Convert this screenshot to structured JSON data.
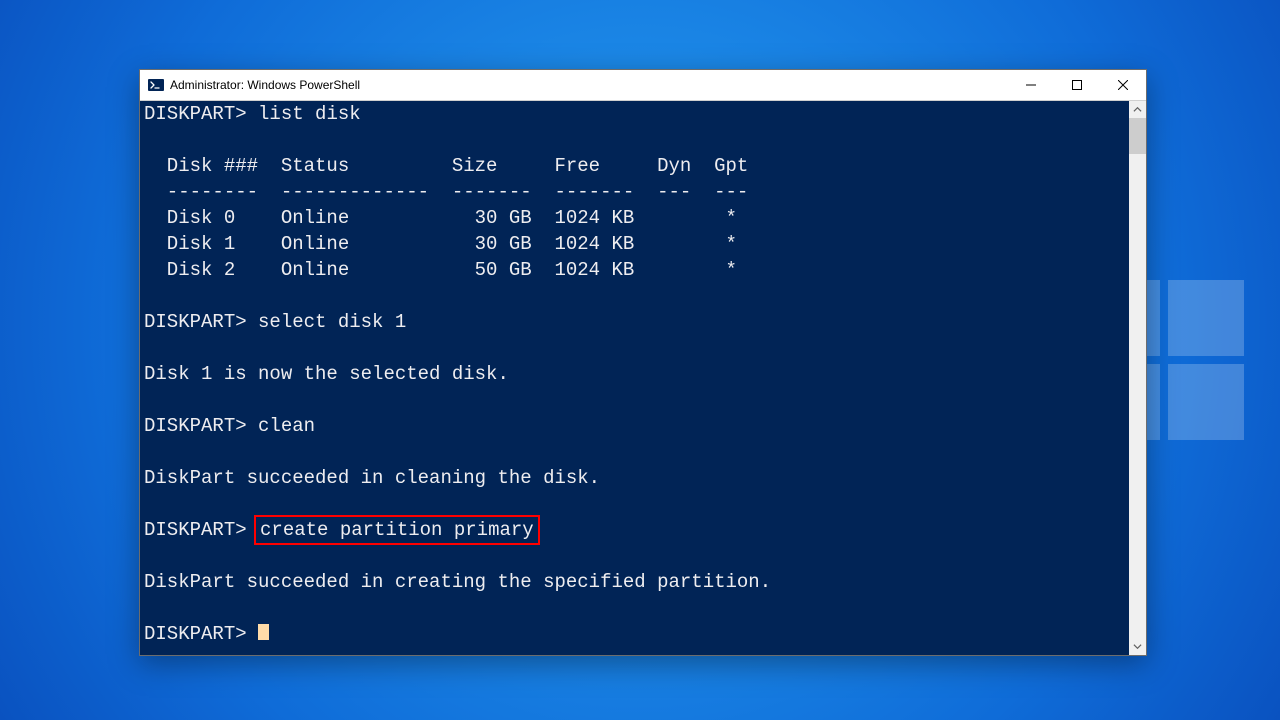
{
  "window": {
    "title": "Administrator: Windows PowerShell"
  },
  "terminal": {
    "prompt": "DISKPART>",
    "cmd_list_disk": "list disk",
    "header": "  Disk ###  Status         Size     Free     Dyn  Gpt",
    "divider": "  --------  -------------  -------  -------  ---  ---",
    "row0": "  Disk 0    Online           30 GB  1024 KB        *",
    "row1": "  Disk 1    Online           30 GB  1024 KB        *",
    "row2": "  Disk 2    Online           50 GB  1024 KB        *",
    "cmd_select": "select disk 1",
    "msg_selected": "Disk 1 is now the selected disk.",
    "cmd_clean": "clean",
    "msg_cleaned": "DiskPart succeeded in cleaning the disk.",
    "cmd_create": "create partition primary",
    "msg_created": "DiskPart succeeded in creating the specified partition.",
    "disks": [
      {
        "id": "Disk 0",
        "status": "Online",
        "size": "30 GB",
        "free": "1024 KB",
        "dyn": "",
        "gpt": "*"
      },
      {
        "id": "Disk 1",
        "status": "Online",
        "size": "30 GB",
        "free": "1024 KB",
        "dyn": "",
        "gpt": "*"
      },
      {
        "id": "Disk 2",
        "status": "Online",
        "size": "50 GB",
        "free": "1024 KB",
        "dyn": "",
        "gpt": "*"
      }
    ]
  }
}
